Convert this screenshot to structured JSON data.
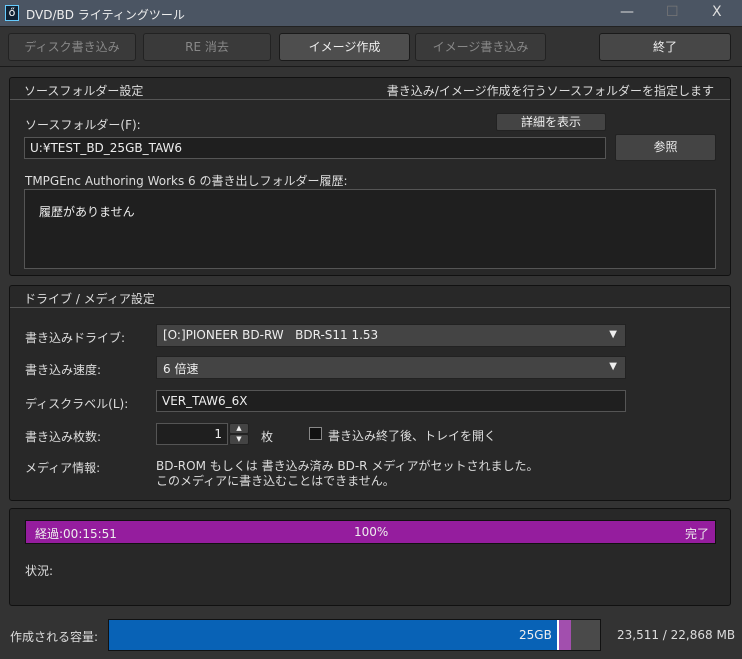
{
  "window": {
    "title": "DVD/BD ライティングツール",
    "minimize": "—",
    "maximize": "☐",
    "close": "X"
  },
  "tabs": [
    {
      "label": "ディスク書き込み"
    },
    {
      "label": "RE 消去"
    },
    {
      "label": "イメージ作成"
    },
    {
      "label": "イメージ書き込み"
    }
  ],
  "exit_label": "終了",
  "source": {
    "header": "ソースフォルダー設定",
    "hint": "書き込み/イメージ作成を行うソースフォルダーを指定します",
    "folder_label": "ソースフォルダー(F):",
    "details_button": "詳細を表示",
    "folder_value": "U:¥TEST_BD_25GB_TAW6",
    "browse_button": "参照",
    "history_label": "TMPGEnc Authoring Works 6 の書き出しフォルダー履歴:",
    "history_empty": "履歴がありません"
  },
  "drive": {
    "header": "ドライブ / メディア設定",
    "drive_label": "書き込みドライブ:",
    "drive_value": "[O:]PIONEER BD-RW   BDR-S11 1.53",
    "speed_label": "書き込み速度:",
    "speed_value": "6 倍速",
    "disc_label_label": "ディスクラベル(L):",
    "disc_label_value": "VER_TAW6_6X",
    "copies_label": "書き込み枚数:",
    "copies_value": "1",
    "copies_unit": "枚",
    "eject_label": "書き込み終了後、トレイを開く",
    "eject_checked": false,
    "media_label": "メディア情報:",
    "media_line1": "BD-ROM もしくは 書き込み済み BD-R メディアがセットされました。",
    "media_line2": "このメディアに書き込むことはできません。"
  },
  "progress": {
    "elapsed": "経過:00:15:51",
    "percent_text": "100%",
    "percent": 100,
    "done": "完了",
    "status_label": "状況:",
    "color": "#951d9e"
  },
  "capacity": {
    "label": "作成される容量:",
    "disc_size": "25GB",
    "value_text": "23,511 / 22,868 MB",
    "used_mb": 23511,
    "capacity_mb": 22868
  }
}
